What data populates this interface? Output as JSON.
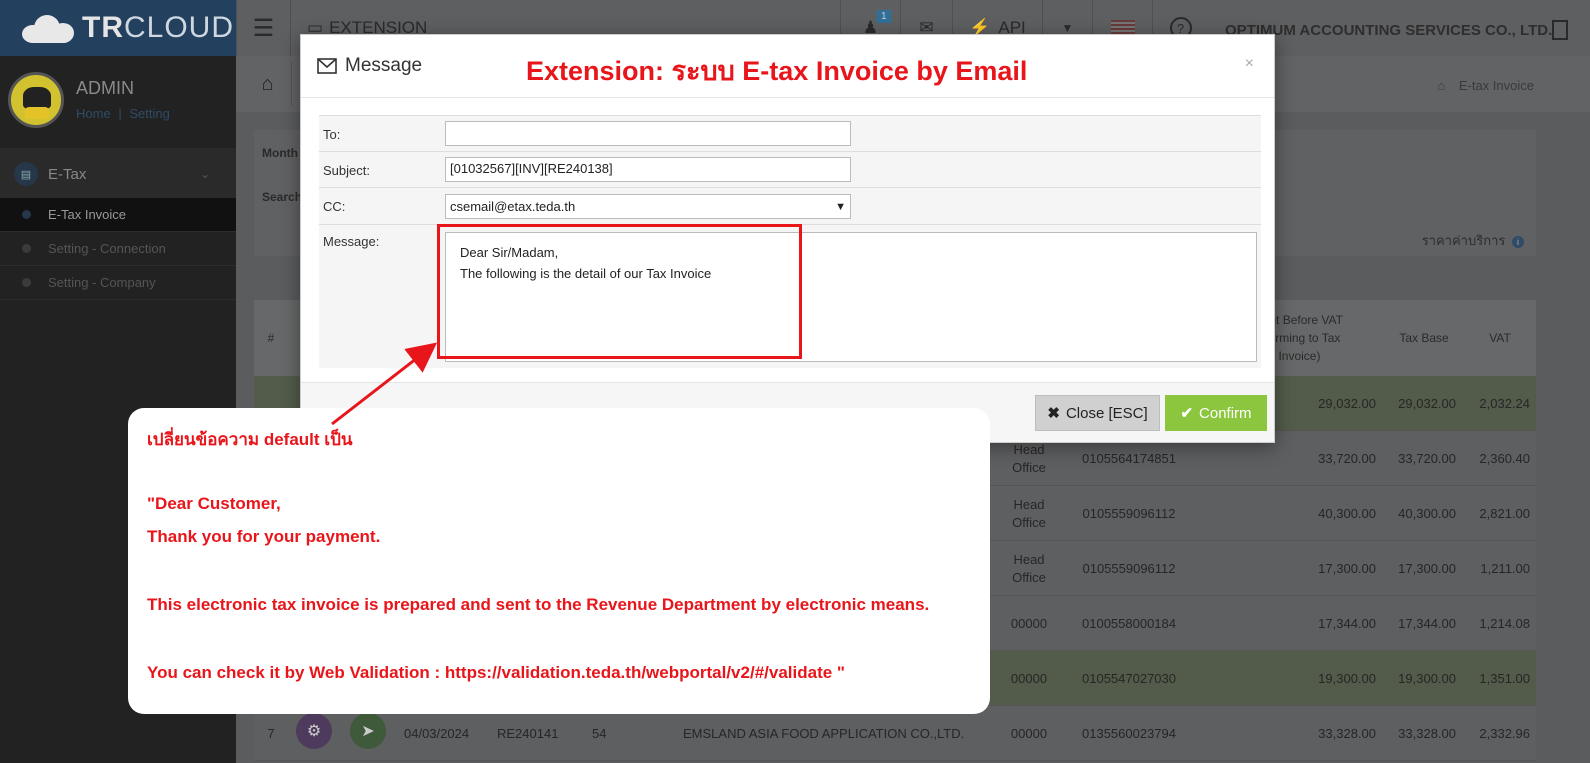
{
  "app": {
    "logo_bold": "TR",
    "logo_light": "CLOUD"
  },
  "topbar": {
    "extension_label": "EXTENSION",
    "api_label": "API",
    "notification_count": "1",
    "company_name": "OPTIMUM ACCOUNTING SERVICES CO., LTD."
  },
  "sidebar": {
    "user": "ADMIN",
    "home_link": "Home",
    "setting_link": "Setting",
    "section": "E-Tax",
    "items": [
      {
        "label": "E-Tax Invoice"
      },
      {
        "label": "Setting - Connection"
      },
      {
        "label": "Setting - Company"
      }
    ]
  },
  "page": {
    "breadcrumb": "E-tax Invoice",
    "filter_month": "Month",
    "filter_search": "Search",
    "price_label": "ราคาค่าบริการ"
  },
  "table": {
    "headers": {
      "index": "#",
      "amount_before_vat": "ount Before VAT\nnforming to Tax\nInvoice)",
      "tax_base": "Tax Base",
      "vat": "VAT"
    },
    "rows": [
      {
        "branch": "",
        "tax_id": "",
        "amount": "29,032.00",
        "base": "29,032.00",
        "vat": "2,032.24"
      },
      {
        "branch": "Head\nOffice",
        "tax_id": "0105564174851",
        "amount": "33,720.00",
        "base": "33,720.00",
        "vat": "2,360.40"
      },
      {
        "branch": "Head\nOffice",
        "tax_id": "0105559096112",
        "amount": "40,300.00",
        "base": "40,300.00",
        "vat": "2,821.00"
      },
      {
        "branch": "Head\nOffice",
        "tax_id": "0105559096112",
        "amount": "17,300.00",
        "base": "17,300.00",
        "vat": "1,211.00"
      },
      {
        "branch": "00000",
        "tax_id": "0100558000184",
        "amount": "17,344.00",
        "base": "17,344.00",
        "vat": "1,214.08"
      },
      {
        "branch": "00000",
        "tax_id": "0105547027030",
        "amount": "19,300.00",
        "base": "19,300.00",
        "vat": "1,351.00"
      },
      {
        "index": "7",
        "date": "04/03/2024",
        "doc": "RE240141",
        "num": "54",
        "customer": "EMSLAND ASIA FOOD APPLICATION CO.,LTD.",
        "branch": "00000",
        "tax_id": "0135560023794",
        "amount": "33,328.00",
        "base": "33,328.00",
        "vat": "2,332.96"
      }
    ]
  },
  "modal": {
    "title": "Message",
    "extension_title": "Extension: ระบบ E-tax Invoice by Email",
    "close_x": "×",
    "to_label": "To:",
    "to_value": "",
    "subject_label": "Subject:",
    "subject_value": "[01032567][INV][RE240138]",
    "cc_label": "CC:",
    "cc_value": "csemail@etax.teda.th",
    "message_label": "Message:",
    "message_value": "Dear Sir/Madam,\nThe following is the detail of our Tax Invoice",
    "close_button": "Close [ESC]",
    "confirm_button": "Confirm"
  },
  "callout": {
    "lines": [
      "เปลี่ยนข้อความ default เป็น",
      "\"Dear Customer,",
      "Thank you for your payment.",
      "This electronic tax invoice is prepared and sent to the Revenue Department by electronic means.",
      "You can check it by Web Validation : https://validation.teda.th/webportal/v2/#/validate \""
    ]
  },
  "colors": {
    "annotation_red": "#e8161b",
    "confirm_green": "#8cc63f",
    "overlay": "#58595b"
  }
}
